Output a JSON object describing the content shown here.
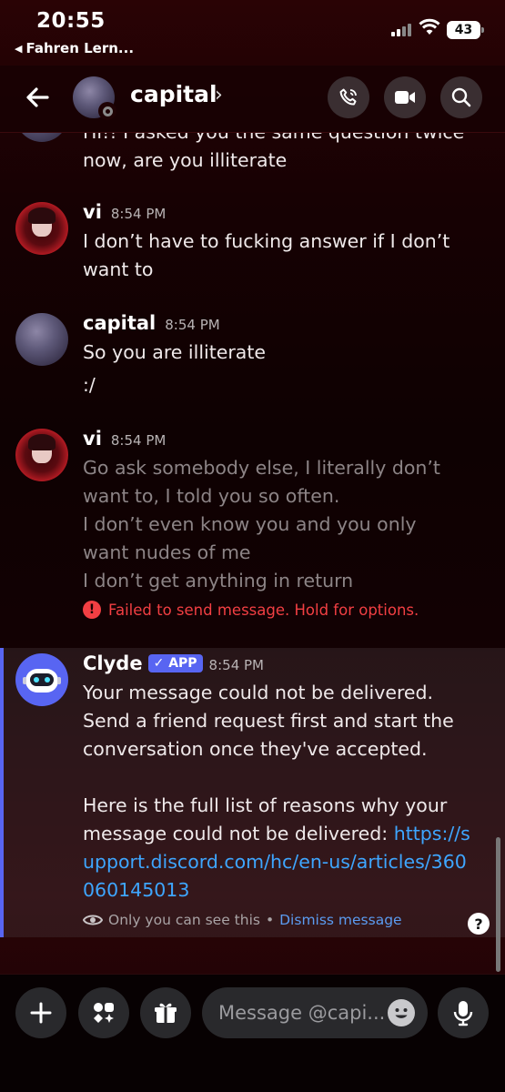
{
  "status_bar": {
    "time": "20:55",
    "back_app": "Fahren Lern...",
    "battery": "43"
  },
  "header": {
    "channel": "capital",
    "chevron": "›"
  },
  "messages": {
    "partial": {
      "line1": "Hi!! I asked you the same question twice",
      "line2": "now, are you illiterate"
    },
    "m1": {
      "author": "vi",
      "time": "8:54 PM",
      "text": "I don’t have to fucking answer  if I don’t want to"
    },
    "m2": {
      "author": "capital",
      "time": "8:54 PM",
      "line1": "So you are illiterate",
      "line2": ":/"
    },
    "m3": {
      "author": "vi",
      "time": "8:54 PM",
      "line1": "Go ask somebody else, I literally don’t want to, I told you so often.",
      "line2": "I don’t even know you and you only want nudes of me",
      "line3": "I don’t get anything in return",
      "failed": "Failed to send message. Hold for options."
    },
    "clyde": {
      "author": "Clyde",
      "badge": "APP",
      "time": "8:54 PM",
      "text1": "Your message could not be delivered. Send a friend request first and start the conversation once they've accepted.",
      "text2": "Here is the full list of reasons why your message could not be delivered: ",
      "link": "https://support.discord.com/hc/en-us/articles/360060145013",
      "only_you": "Only you can see this",
      "separator": "•",
      "dismiss": "Dismiss message"
    }
  },
  "composer": {
    "placeholder": "Message @capi..."
  },
  "icons": {
    "back": "arrow-left-icon",
    "call": "phone-icon",
    "video": "video-camera-icon",
    "search": "search-icon",
    "add": "plus-icon",
    "apps": "apps-icon",
    "gift": "gift-icon",
    "emoji": "emoji-icon",
    "mic": "microphone-icon",
    "failed": "exclamation-icon",
    "eye": "eye-icon",
    "help": "question-icon"
  },
  "colors": {
    "accent": "#5865f2",
    "error": "#f23f43",
    "link": "#3ea6ff"
  }
}
